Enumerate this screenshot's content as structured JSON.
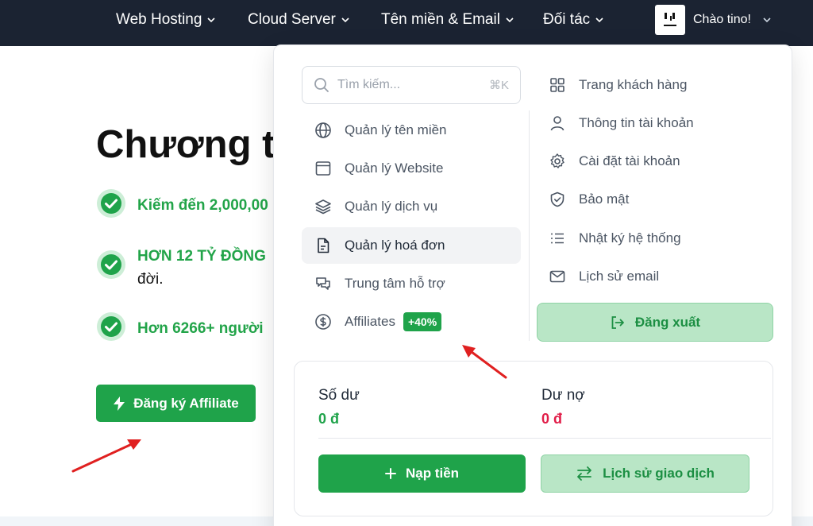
{
  "nav": {
    "items": [
      {
        "label": "Web Hosting"
      },
      {
        "label": "Cloud Server"
      },
      {
        "label": "Tên miền & Email"
      },
      {
        "label": "Đối tác"
      }
    ],
    "greeting": "Chào tino!"
  },
  "hero": {
    "title": "Chương trì",
    "bullets": [
      {
        "text": "Kiếm đến 2,000,00"
      },
      {
        "text": "HƠN 12 TỶ ĐỒNG",
        "extra": "đời."
      },
      {
        "text": "Hơn 6266+ người"
      }
    ],
    "cta_label": "Đăng ký Affiliate"
  },
  "dropdown": {
    "search": {
      "placeholder": "Tìm kiếm...",
      "shortcut": "⌘K"
    },
    "left_menu": [
      {
        "label": "Quản lý tên miền",
        "icon": "globe-icon"
      },
      {
        "label": "Quản lý Website",
        "icon": "browser-icon"
      },
      {
        "label": "Quản lý dịch vụ",
        "icon": "layers-icon"
      },
      {
        "label": "Quản lý hoá đơn",
        "icon": "invoice-icon",
        "active": true
      },
      {
        "label": "Trung tâm hỗ trợ",
        "icon": "chat-icon"
      },
      {
        "label": "Affiliates",
        "icon": "dollar-icon",
        "badge": "+40%"
      }
    ],
    "right_menu": [
      {
        "label": "Trang khách hàng",
        "icon": "grid-icon"
      },
      {
        "label": "Thông tin tài khoản",
        "icon": "user-icon"
      },
      {
        "label": "Cài đặt tài khoản",
        "icon": "gear-icon"
      },
      {
        "label": "Bảo mật",
        "icon": "shield-icon"
      },
      {
        "label": "Nhật ký hệ thống",
        "icon": "list-icon"
      },
      {
        "label": "Lịch sử email",
        "icon": "mail-icon"
      }
    ],
    "logout_label": "Đăng xuất",
    "wallet": {
      "balance_label": "Số dư",
      "balance_value": "0 đ",
      "debt_label": "Dư nợ",
      "debt_value": "0 đ",
      "topup_label": "Nạp tiền",
      "history_label": "Lịch sử giao dịch"
    }
  },
  "colors": {
    "nav_bg": "#1b2332",
    "primary_green": "#1fa34a",
    "light_green": "#b9e6c6",
    "debt_red": "#e11d48",
    "annotation_red": "#e02020"
  }
}
